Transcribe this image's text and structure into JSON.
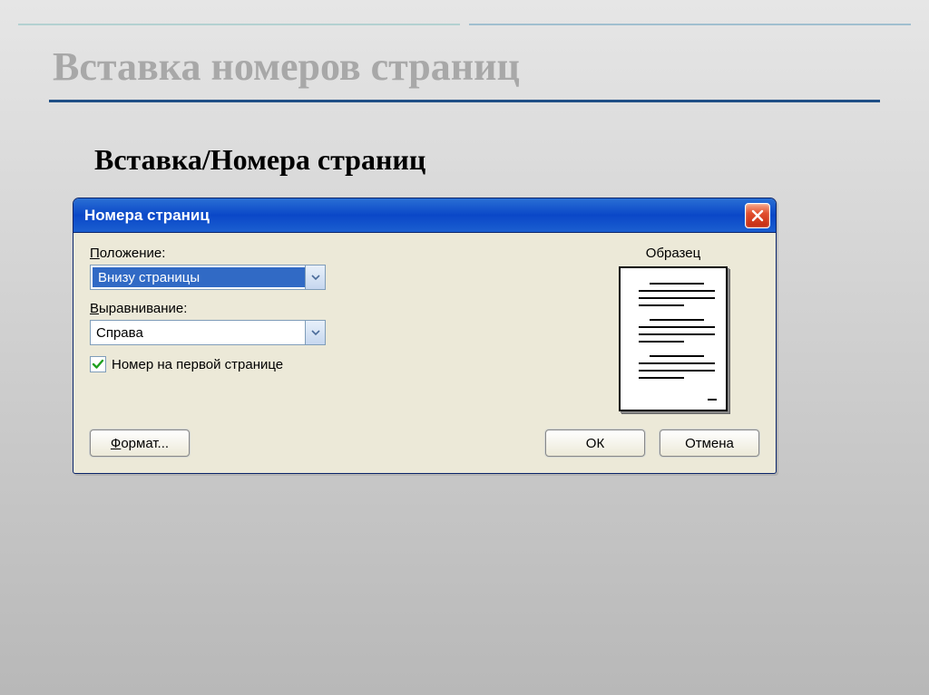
{
  "slide": {
    "title": "Вставка номеров страниц",
    "subhead": "Вставка/Номера страниц"
  },
  "dialog": {
    "title": "Номера страниц",
    "position_label_prefix": "П",
    "position_label_rest": "оложение:",
    "position_value": "Внизу страницы",
    "align_label_prefix": "В",
    "align_label_rest": "ыравнивание:",
    "align_value": "Справа",
    "checkbox_prefix": "Н",
    "checkbox_rest": "омер на первой странице",
    "sample_label": "Образец",
    "format_button_prefix": "Ф",
    "format_button_rest": "ормат...",
    "ok_button": "ОК",
    "cancel_button": "Отмена"
  }
}
